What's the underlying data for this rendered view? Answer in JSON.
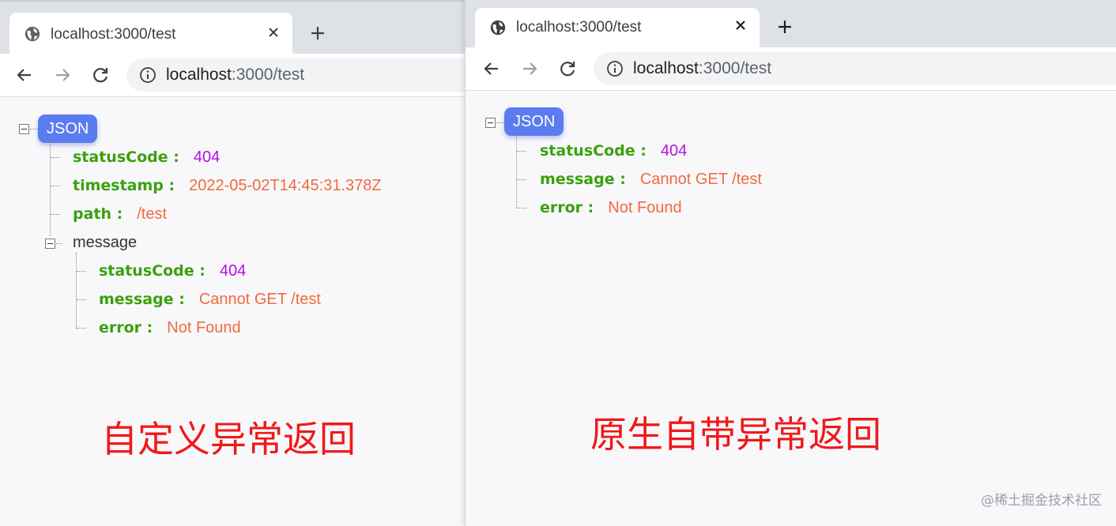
{
  "left_window": {
    "tab_title": "localhost:3000/test",
    "url_host": "localhost",
    "url_path": ":3000/test",
    "root_label": "JSON",
    "fields": {
      "statusCode_key": "statusCode :",
      "statusCode_val": "404",
      "timestamp_key": "timestamp :",
      "timestamp_val": "2022-05-02T14:45:31.378Z",
      "path_key": "path :",
      "path_val": "/test",
      "message_label": "message"
    },
    "message_fields": {
      "statusCode_key": "statusCode :",
      "statusCode_val": "404",
      "message_key": "message :",
      "message_val": "Cannot GET /test",
      "error_key": "error :",
      "error_val": "Not Found"
    },
    "caption": "自定义异常返回"
  },
  "right_window": {
    "tab_title": "localhost:3000/test",
    "url_host": "localhost",
    "url_path": ":3000/test",
    "root_label": "JSON",
    "fields": {
      "statusCode_key": "statusCode :",
      "statusCode_val": "404",
      "message_key": "message :",
      "message_val": "Cannot GET /test",
      "error_key": "error :",
      "error_val": "Not Found"
    },
    "caption": "原生自带异常返回"
  },
  "watermark": "@稀土掘金技术社区",
  "colors": {
    "key": "#3aa10c",
    "number": "#b60fe0",
    "string": "#f26a3e",
    "pill": "#5b7cf0",
    "caption": "#f01919"
  },
  "icons": [
    "globe-icon",
    "close-icon",
    "plus-icon",
    "back-arrow-icon",
    "forward-arrow-icon",
    "reload-icon",
    "info-icon",
    "collapse-toggle-icon"
  ]
}
